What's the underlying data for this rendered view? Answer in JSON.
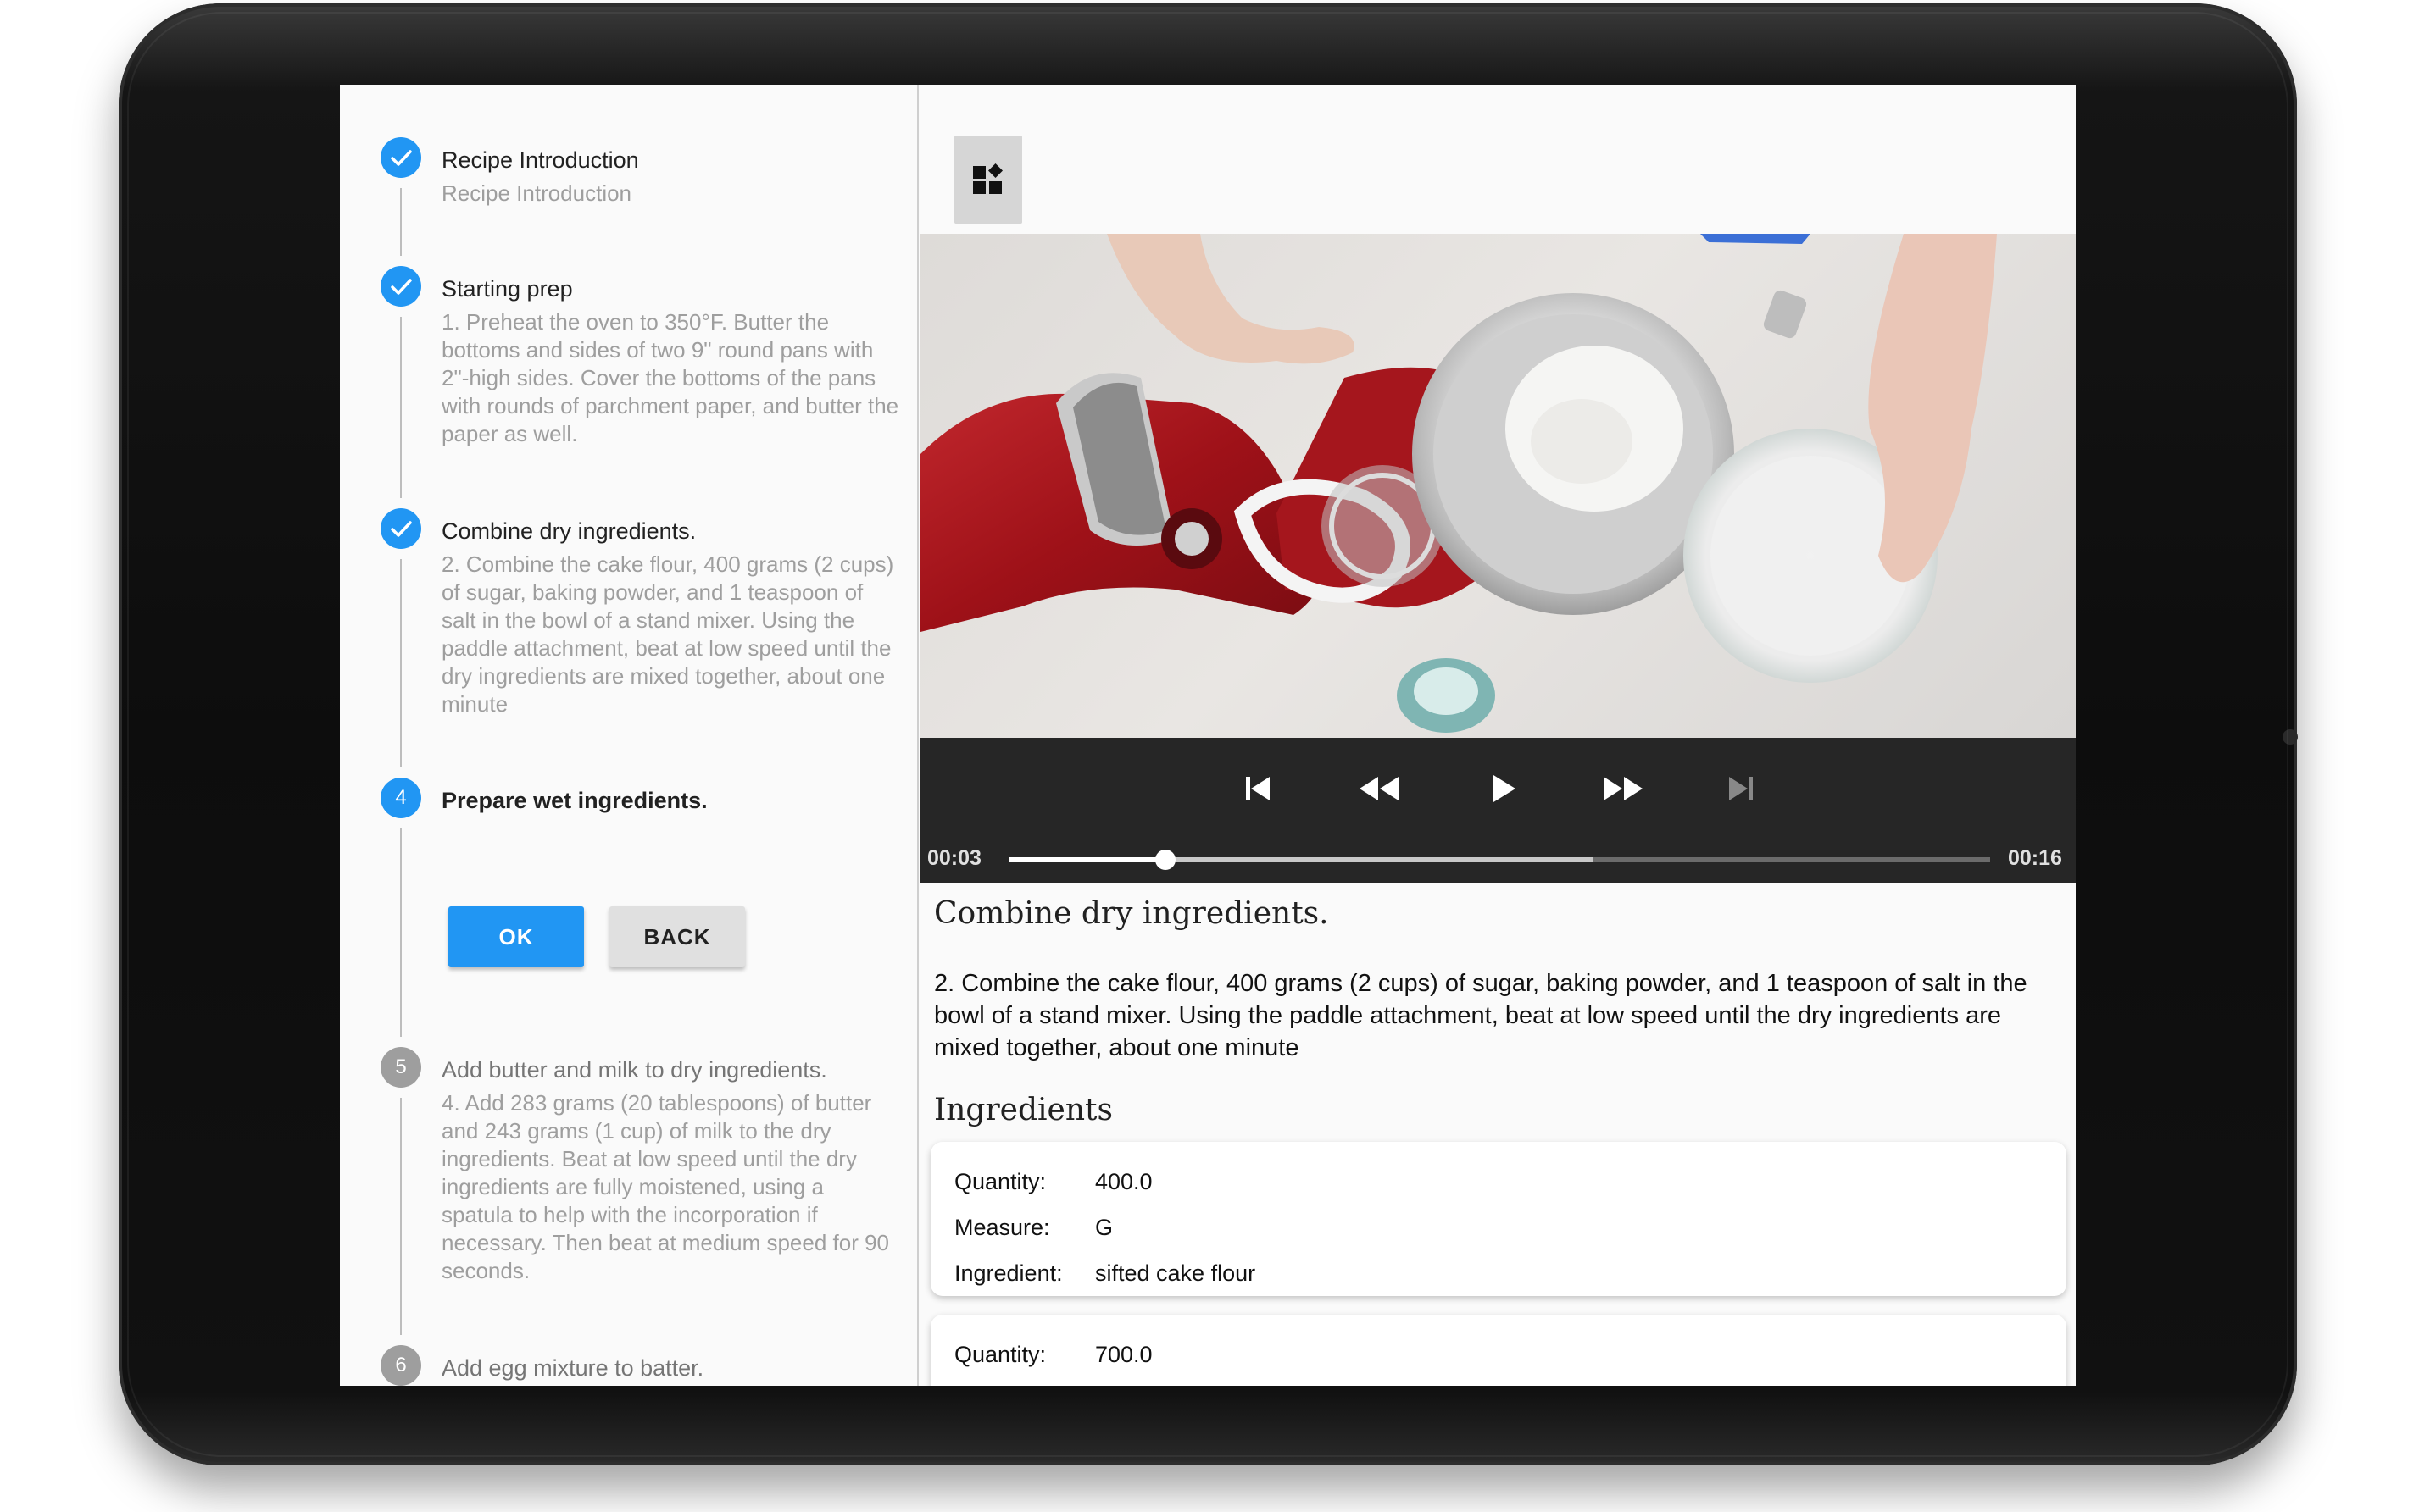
{
  "steps": [
    {
      "number": "✓",
      "title": "Recipe Introduction",
      "description": "Recipe Introduction",
      "state": "complete"
    },
    {
      "number": "✓",
      "title": "Starting prep",
      "description": "1. Preheat the oven to 350°F. Butter the bottoms and sides of two 9\" round pans with 2\"-high sides. Cover the bottoms of the pans with rounds of parchment paper, and butter the paper as well.",
      "state": "complete"
    },
    {
      "number": "✓",
      "title": "Combine dry ingredients.",
      "description": "2. Combine the cake flour, 400 grams (2 cups) of sugar, baking powder, and 1 teaspoon of salt in the bowl of a stand mixer. Using the paddle attachment, beat at low speed until the dry ingredients are mixed together, about one minute",
      "state": "complete"
    },
    {
      "number": "4",
      "title": "Prepare wet ingredients.",
      "description": "",
      "state": "active"
    },
    {
      "number": "5",
      "title": "Add butter and milk to dry ingredients.",
      "description": "4. Add 283 grams (20 tablespoons) of butter and 243 grams (1 cup) of milk to the dry ingredients. Beat at low speed until the dry ingredients are fully moistened, using a spatula to help with the incorporation if necessary. Then beat at medium speed for 90 seconds.",
      "state": "pending"
    },
    {
      "number": "6",
      "title": "Add egg mixture to batter.",
      "description": "",
      "state": "pending"
    }
  ],
  "buttons": {
    "ok": "OK",
    "back": "BACK"
  },
  "player": {
    "current_time": "00:03",
    "duration": "00:16",
    "played_fraction": 0.16,
    "buffered_fraction": 0.595
  },
  "detail": {
    "title": "Combine dry ingredients.",
    "body": "2. Combine the cake flour, 400 grams (2 cups) of sugar, baking powder, and 1 teaspoon of salt in the bowl of a stand mixer. Using the paddle attachment, beat at low speed until the dry ingredients are mixed together, about one minute",
    "ingredients_heading": "Ingredients"
  },
  "ingredient_labels": {
    "quantity": "Quantity:",
    "measure": "Measure:",
    "ingredient": "Ingredient:"
  },
  "ingredients": [
    {
      "quantity": "400.0",
      "measure": "G",
      "ingredient": "sifted cake flour"
    },
    {
      "quantity": "700.0"
    }
  ],
  "icons": {
    "widget": "widgets-icon",
    "skip_previous": "skip-previous-icon",
    "rewind": "rewind-icon",
    "play": "play-icon",
    "fast_forward": "fast-forward-icon",
    "skip_next": "skip-next-icon",
    "check": "check-icon"
  },
  "colors": {
    "accent": "#2196f3",
    "pending": "#9e9e9e",
    "player_bg": "#262626"
  }
}
